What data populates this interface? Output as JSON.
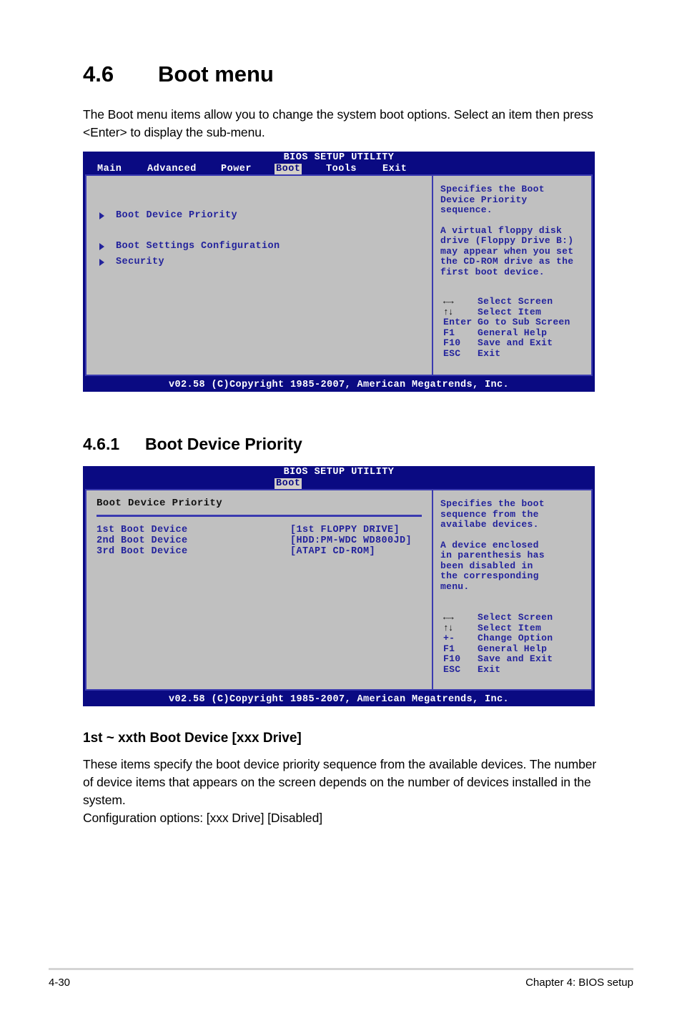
{
  "document": {
    "section": {
      "number": "4.6",
      "title": "Boot menu",
      "intro": "The Boot menu items allow you to change the system boot options. Select an item then press <Enter> to display the sub-menu."
    },
    "subsection": {
      "number": "4.6.1",
      "title": "Boot Device Priority"
    },
    "item": {
      "heading": "1st ~ xxth Boot Device [xxx Drive]",
      "body": "These items specify the boot device priority sequence from the available devices. The number of device items that appears on the screen depends on the number of devices installed in the system.\nConfiguration options: [xxx Drive] [Disabled]"
    },
    "footer": {
      "page_number": "4-30",
      "chapter": "Chapter 4: BIOS setup"
    }
  },
  "bios_screen_1": {
    "title": "BIOS SETUP UTILITY",
    "tabs": [
      {
        "label": "Main",
        "active": false
      },
      {
        "label": "Advanced",
        "active": false
      },
      {
        "label": "Power",
        "active": false
      },
      {
        "label": "Boot",
        "active": true
      },
      {
        "label": "Tools",
        "active": false
      },
      {
        "label": "Exit",
        "active": false
      }
    ],
    "menu_items": [
      {
        "label": "Boot Device Priority"
      },
      {
        "label": "Boot Settings Configuration"
      },
      {
        "label": "Security"
      }
    ],
    "help": [
      "Specifies the Boot\nDevice Priority\nsequence.",
      "A virtual floppy disk\ndrive (Floppy Drive B:)\nmay appear when you set\nthe CD-ROM drive as the\nfirst boot device."
    ],
    "keys": [
      {
        "glyph": "←→",
        "name": "",
        "action": "Select Screen"
      },
      {
        "glyph": "↑↓",
        "name": "",
        "action": "Select Item"
      },
      {
        "glyph": "",
        "name": "Enter",
        "action": "Go to Sub Screen"
      },
      {
        "glyph": "",
        "name": "F1",
        "action": "General Help"
      },
      {
        "glyph": "",
        "name": "F10",
        "action": "Save and Exit"
      },
      {
        "glyph": "",
        "name": "ESC",
        "action": "Exit"
      }
    ],
    "copyright": "v02.58 (C)Copyright 1985-2007, American Megatrends, Inc."
  },
  "bios_screen_2": {
    "title": "BIOS SETUP UTILITY",
    "tabs": [
      {
        "label": "Boot",
        "active": true
      }
    ],
    "panel_title": "Boot Device Priority",
    "devices": [
      {
        "label": "1st Boot Device",
        "value": "[1st FLOPPY DRIVE]"
      },
      {
        "label": "2nd Boot Device",
        "value": "[HDD:PM-WDC WD800JD]"
      },
      {
        "label": "3rd Boot Device",
        "value": "[ATAPI CD-ROM]"
      }
    ],
    "help": [
      "Specifies the boot\nsequence from the\navailabe devices.",
      "A device enclosed\nin parenthesis has\nbeen disabled in\nthe corresponding\nmenu."
    ],
    "keys": [
      {
        "glyph": "←→",
        "name": "",
        "action": "Select Screen"
      },
      {
        "glyph": "↑↓",
        "name": "",
        "action": "Select Item"
      },
      {
        "glyph": "",
        "name": "+-",
        "action": "Change Option"
      },
      {
        "glyph": "",
        "name": "F1",
        "action": "General Help"
      },
      {
        "glyph": "",
        "name": "F10",
        "action": "Save and Exit"
      },
      {
        "glyph": "",
        "name": "ESC",
        "action": "Exit"
      }
    ],
    "copyright": "v02.58 (C)Copyright 1985-2007, American Megatrends, Inc."
  },
  "colors": {
    "bios_blue": "#0a0a82",
    "panel_gray": "#c0c0c0",
    "text_blue": "#23239c",
    "border_blue": "#3a3ab0",
    "tab_active_bg": "#d4d0c8"
  }
}
